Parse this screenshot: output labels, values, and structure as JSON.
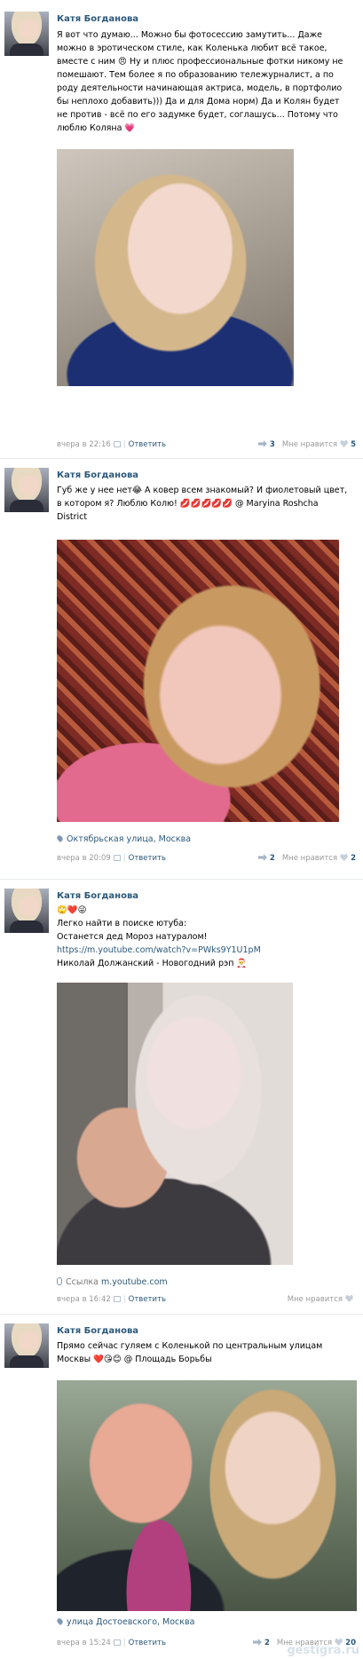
{
  "posts": [
    {
      "author": "Катя Богданова",
      "text": "Я вот что думаю... Можно бы фотосессию замутить... Даже можно в эротическом стиле, как Коленька любит всё такое, вместе с ним 😠 Ну и плюс профессиональные фотки никому не помешают. Тем более я по образованию тележурналист, а по роду деятельности начинающая актриса, модель, в портфолио бы неплохо добавить))) Да и для Дома норм) Да и Колян будет не против - всё по его задумке будет, соглашусь... Потому что люблю Коляна 💗",
      "date": "вчера в 22:16",
      "reply": "Ответить",
      "shares": "3",
      "like_label": "Мне нравится",
      "likes": "5"
    },
    {
      "author": "Катя Богданова",
      "text": "Губ же у нее нет😂 А ковер всем знакомый? И фиолетовый цвет, в котором я? Люблю Колю! 💋💋💋💋💋 @ Maryina Roshcha District",
      "location": "Октябрьская улица, Москва",
      "date": "вчера в 20:09",
      "reply": "Ответить",
      "shares": "2",
      "like_label": "Мне нравится",
      "likes": "2"
    },
    {
      "author": "Катя Богданова",
      "line1": "🙄❤️😜",
      "line2": "Легко найти в поиске ютуба:",
      "line3": "Останется дед Мороз натуралом!",
      "url": "https://m.youtube.com/watch?v=PWks9Y1U1pM",
      "line5": "Николай Должанский - Новогодний рэп 🎅",
      "attach_label": "Ссылка",
      "attach_host": "m.youtube.com",
      "date": "вчера в 16:42",
      "reply": "Ответить",
      "like_label": "Мне нравится"
    },
    {
      "author": "Катя Богданова",
      "text": "Прямо сейчас гуляем с Коленькой по центральным улицам Москвы ❤️😘😊 @ Площадь Борьбы",
      "location": "улица Достоевского, Москва",
      "date": "вчера в 15:24",
      "reply": "Ответить",
      "shares": "2",
      "like_label": "Мне нравится",
      "likes": "20"
    }
  ],
  "watermark": "gestigra.ru",
  "colors": {
    "link": "#2b587a",
    "muted": "#999999",
    "divider": "#e7eaed"
  }
}
